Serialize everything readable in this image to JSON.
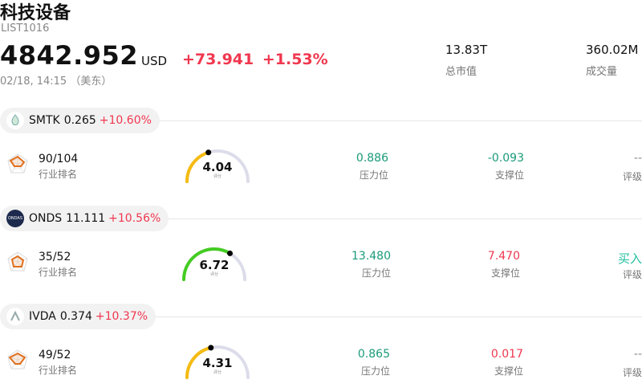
{
  "header": {
    "title": "科技设备",
    "code": "LIST1016",
    "price": "4842.952",
    "currency": "USD",
    "change": "+73.941",
    "change_pct": "+1.53%",
    "time": "02/18, 14:15 （美东）",
    "market_cap_value": "13.83T",
    "market_cap_label": "总市值",
    "volume_value": "360.02M",
    "volume_label": "成交量"
  },
  "colors": {
    "up": "#f0374f",
    "support_level": "#1a9a7a",
    "buy": "#22bfa0"
  },
  "stocks": [
    {
      "ticker": "SMTK",
      "price": "0.265",
      "change_pct": "+10.60%",
      "rank": "90/104",
      "rank_label": "行业排名",
      "score": "4.04",
      "score_label": "评分",
      "score_fraction": 0.404,
      "pressure": "0.886",
      "pressure_label": "压力位",
      "support": "-0.093",
      "support_label": "支撑位",
      "rating": "--",
      "rating_label": "评级"
    },
    {
      "ticker": "ONDS",
      "price": "11.111",
      "change_pct": "+10.56%",
      "rank": "35/52",
      "rank_label": "行业排名",
      "score": "6.72",
      "score_label": "评分",
      "score_fraction": 0.672,
      "pressure": "13.480",
      "pressure_label": "压力位",
      "support": "7.470",
      "support_label": "支撑位",
      "rating": "买入",
      "rating_label": "评级"
    },
    {
      "ticker": "IVDA",
      "price": "0.374",
      "change_pct": "+10.37%",
      "rank": "49/52",
      "rank_label": "行业排名",
      "score": "4.31",
      "score_label": "评分",
      "score_fraction": 0.431,
      "pressure": "0.865",
      "pressure_label": "压力位",
      "support": "0.017",
      "support_label": "支撑位",
      "rating": "--",
      "rating_label": "评级"
    }
  ]
}
